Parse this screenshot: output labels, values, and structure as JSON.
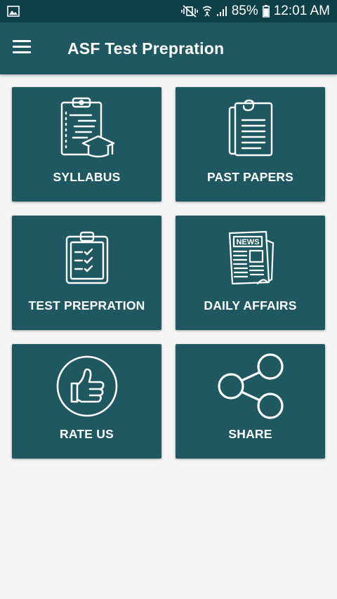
{
  "status_bar": {
    "battery_percent": "85%",
    "time": "12:01 AM",
    "icons": [
      "image-icon",
      "mute-vibrate-icon",
      "wifi-icon",
      "signal-icon",
      "battery-icon"
    ]
  },
  "app_bar": {
    "title": "ASF Test Prepration",
    "menu_icon": "hamburger-menu-icon"
  },
  "menu_cards": [
    {
      "label": "SYLLABUS",
      "icon": "clipboard-graduation-cap-icon"
    },
    {
      "label": "PAST PAPERS",
      "icon": "document-pages-icon"
    },
    {
      "label": "TEST PREPRATION",
      "icon": "checklist-clipboard-icon"
    },
    {
      "label": "DAILY AFFAIRS",
      "icon": "newspaper-icon"
    },
    {
      "label": "RATE US",
      "icon": "thumbs-up-icon"
    },
    {
      "label": "SHARE",
      "icon": "share-icon"
    }
  ],
  "colors": {
    "status_bar": "#0f4048",
    "primary": "#1f5860",
    "background": "#f5f5f5",
    "text_on_primary": "#ffffff"
  }
}
